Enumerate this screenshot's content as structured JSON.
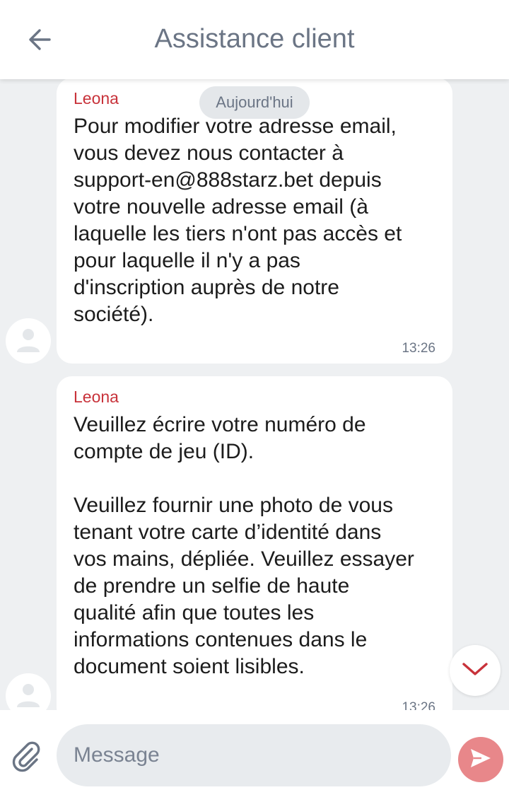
{
  "header": {
    "title": "Assistance client",
    "back_icon": "arrow-left-icon"
  },
  "chat": {
    "date_label": "Aujourd'hui",
    "messages": [
      {
        "sender": "Leona",
        "text": "Pour modifier votre adresse email,\nvous devez nous contacter à\nsupport-en@888starz.bet depuis\nvotre nouvelle adresse email (à\nlaquelle les tiers n'ont pas accès et\npour laquelle il n'y a pas\nd'inscription auprès de notre\nsociété).",
        "time": "13:26"
      },
      {
        "sender": "Leona",
        "text": "Veuillez écrire votre numéro de\ncompte de jeu (ID).\n\nVeuillez fournir une photo de vous\ntenant votre carte d’identité dans\nvos mains, dépliée. Veuillez essayer\nde prendre un selfie de haute\nqualité afin que toutes les\ninformations contenues dans le\ndocument soient lisibles.",
        "time": "13:26"
      }
    ]
  },
  "composer": {
    "placeholder": "Message",
    "attach_icon": "paperclip-icon",
    "send_icon": "send-icon"
  },
  "colors": {
    "accent": "#c8323a",
    "send_button": "#e8878a",
    "chat_background": "#eef0f2",
    "title": "#6b7585"
  }
}
